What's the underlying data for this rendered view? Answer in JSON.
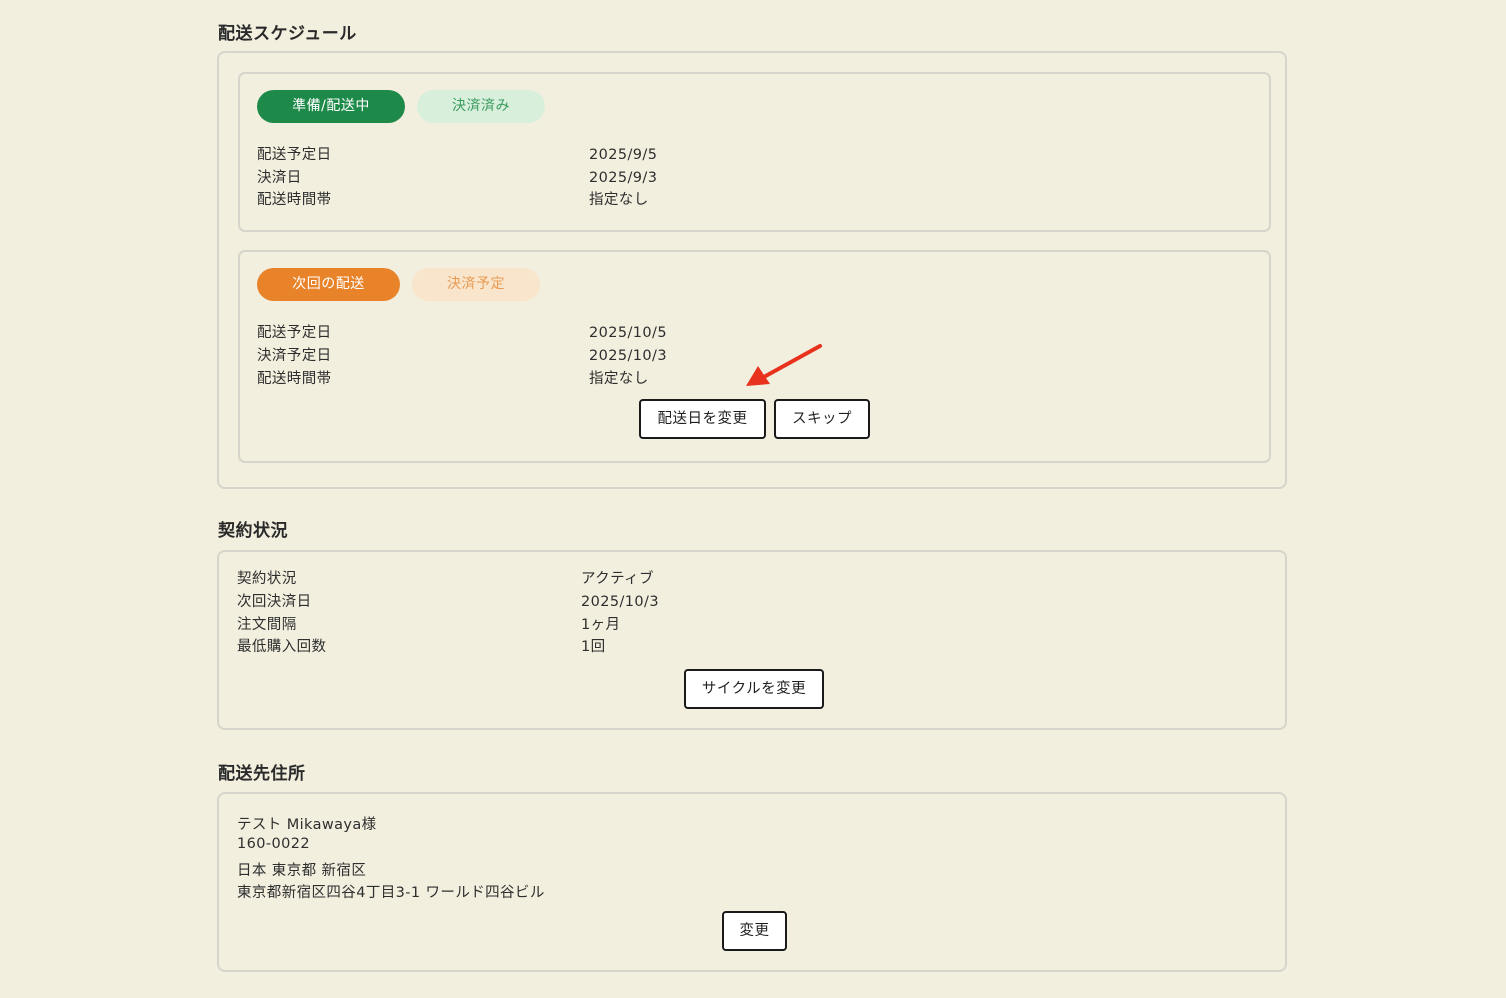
{
  "delivery_schedule": {
    "title": "配送スケジュール",
    "current": {
      "status_pill": "準備/配送中",
      "payment_pill": "決済済み",
      "rows": [
        {
          "label": "配送予定日",
          "value": "2025/9/5"
        },
        {
          "label": "決済日",
          "value": "2025/9/3"
        },
        {
          "label": "配送時間帯",
          "value": "指定なし"
        }
      ]
    },
    "next": {
      "status_pill": "次回の配送",
      "payment_pill": "決済予定",
      "rows": [
        {
          "label": "配送予定日",
          "value": "2025/10/5"
        },
        {
          "label": "決済予定日",
          "value": "2025/10/3"
        },
        {
          "label": "配送時間帯",
          "value": "指定なし"
        }
      ],
      "change_date_button": "配送日を変更",
      "skip_button": "スキップ"
    }
  },
  "contract": {
    "title": "契約状況",
    "rows": [
      {
        "label": "契約状況",
        "value": "アクティブ"
      },
      {
        "label": "次回決済日",
        "value": "2025/10/3"
      },
      {
        "label": "注文間隔",
        "value": "1ヶ月"
      },
      {
        "label": "最低購入回数",
        "value": "1回"
      }
    ],
    "change_cycle_button": "サイクルを変更"
  },
  "address": {
    "title": "配送先住所",
    "lines": [
      "テスト Mikawaya様",
      "160-0022",
      "日本 東京都 新宿区",
      "東京都新宿区四谷4丁目3-1 ワールド四谷ビル"
    ],
    "change_button": "変更"
  },
  "colors": {
    "background": "#f2efdf",
    "green": "#1e8a4a",
    "orange": "#e8832a",
    "annotation_arrow": "#e8321e"
  }
}
